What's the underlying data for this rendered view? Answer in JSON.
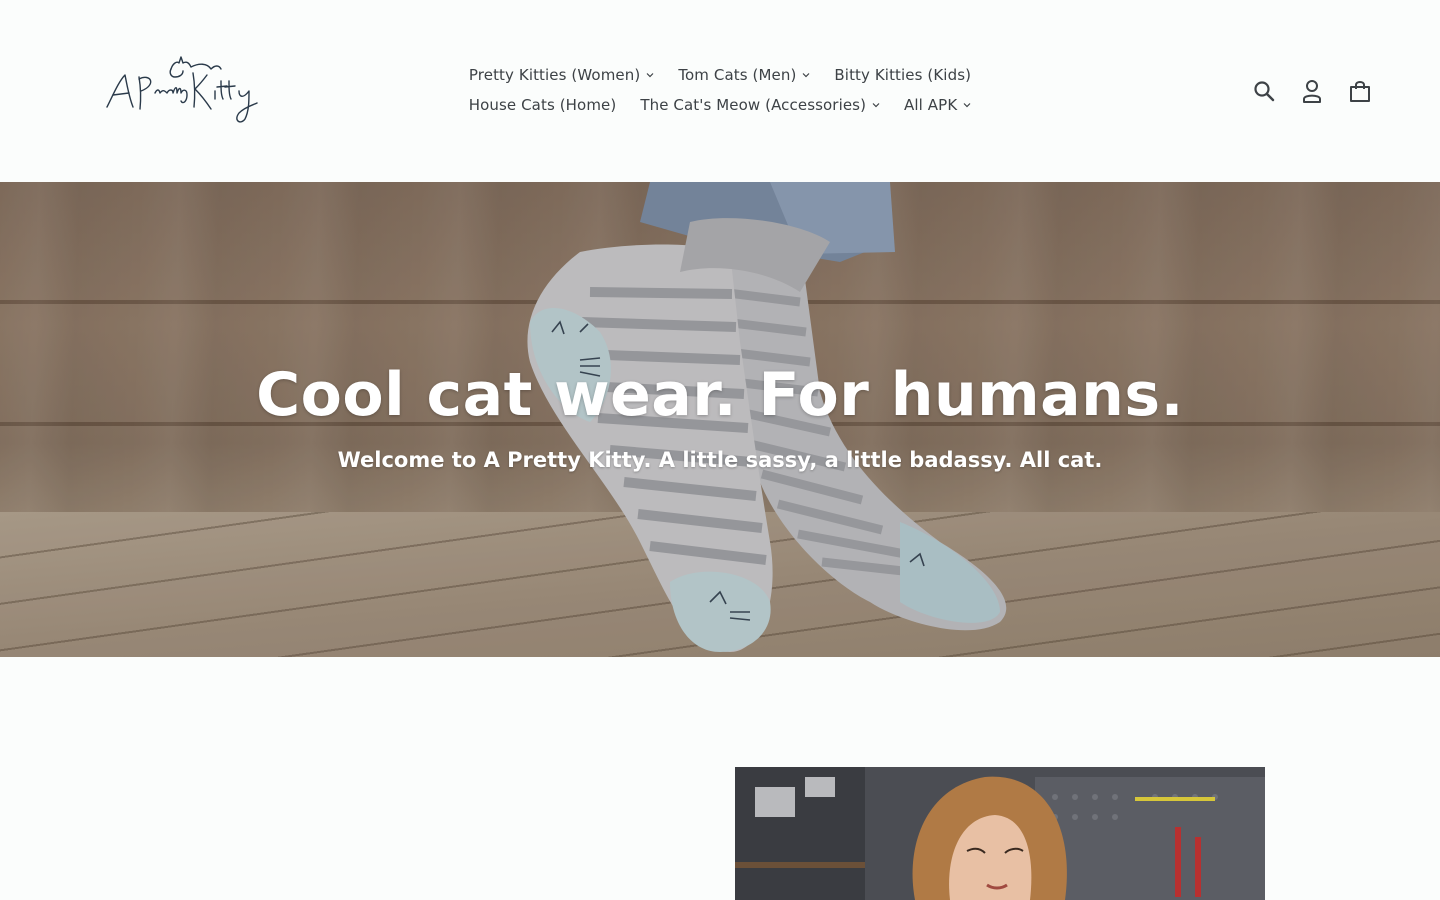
{
  "brand": {
    "logo_text": "A Pretty Kitty"
  },
  "nav": {
    "row1": [
      {
        "label": "Pretty Kitties (Women)",
        "has_dropdown": true
      },
      {
        "label": "Tom Cats (Men)",
        "has_dropdown": true
      },
      {
        "label": "Bitty Kitties (Kids)",
        "has_dropdown": false
      }
    ],
    "row2": [
      {
        "label": "House Cats (Home)",
        "has_dropdown": false
      },
      {
        "label": "The Cat's Meow (Accessories)",
        "has_dropdown": true
      },
      {
        "label": "All APK",
        "has_dropdown": true
      }
    ]
  },
  "header_icons": [
    "search-icon",
    "account-icon",
    "cart-icon"
  ],
  "hero": {
    "title": "Cool cat wear. For humans.",
    "subtitle": "Welcome to A Pretty Kitty. A little sassy, a little badassy. All cat."
  },
  "colors": {
    "background": "#fbfdfc",
    "nav_text": "#3d4246",
    "hero_text": "#ffffff",
    "logo": "#2a3a4a"
  }
}
